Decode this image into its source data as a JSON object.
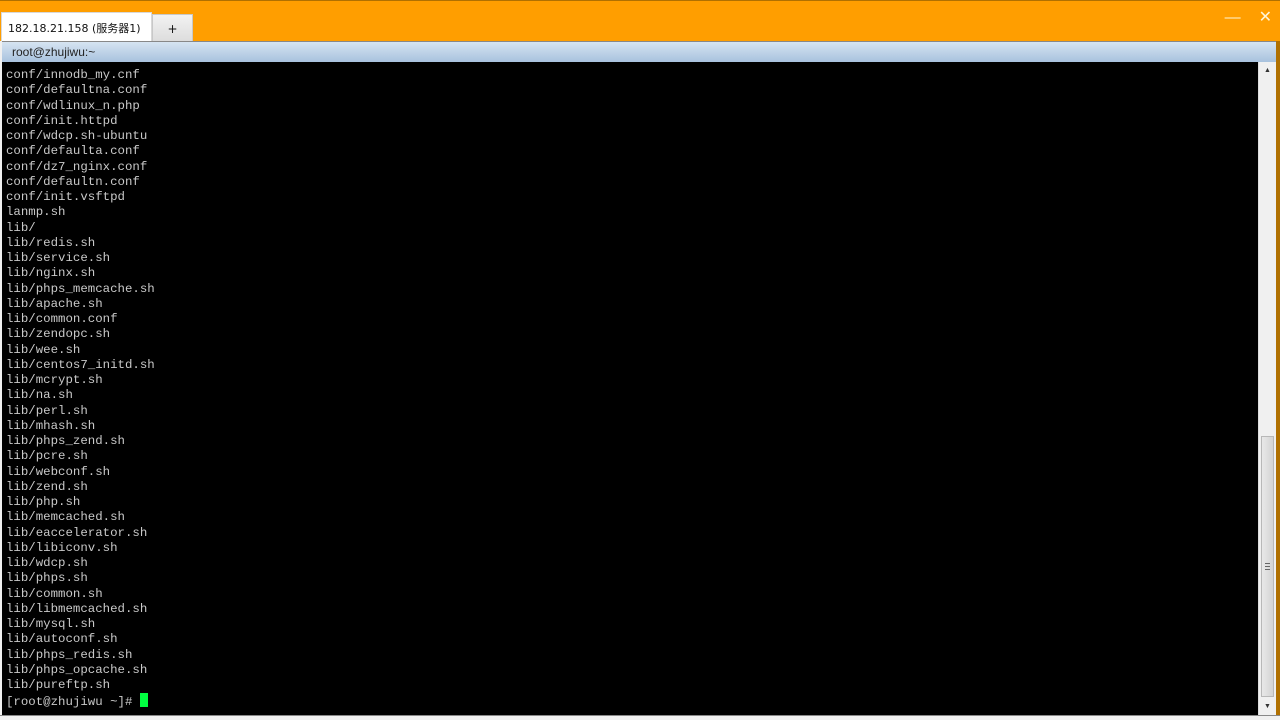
{
  "window": {
    "tabs": [
      {
        "label": "182.18.21.158 (服务器1)",
        "active": true
      },
      {
        "label": "+",
        "active": false
      }
    ],
    "controls": {
      "minimize": "—",
      "close": "✕"
    },
    "accent_color": "#ff9e00"
  },
  "session": {
    "title": "root@zhujiwu:~"
  },
  "terminal": {
    "lines": [
      "conf/innodb_my.cnf",
      "conf/defaultna.conf",
      "conf/wdlinux_n.php",
      "conf/init.httpd",
      "conf/wdcp.sh-ubuntu",
      "conf/defaulta.conf",
      "conf/dz7_nginx.conf",
      "conf/defaultn.conf",
      "conf/init.vsftpd",
      "lanmp.sh",
      "lib/",
      "lib/redis.sh",
      "lib/service.sh",
      "lib/nginx.sh",
      "lib/phps_memcache.sh",
      "lib/apache.sh",
      "lib/common.conf",
      "lib/zendopc.sh",
      "lib/wee.sh",
      "lib/centos7_initd.sh",
      "lib/mcrypt.sh",
      "lib/na.sh",
      "lib/perl.sh",
      "lib/mhash.sh",
      "lib/phps_zend.sh",
      "lib/pcre.sh",
      "lib/webconf.sh",
      "lib/zend.sh",
      "lib/php.sh",
      "lib/memcached.sh",
      "lib/eaccelerator.sh",
      "lib/libiconv.sh",
      "lib/wdcp.sh",
      "lib/phps.sh",
      "lib/common.sh",
      "lib/libmemcached.sh",
      "lib/mysql.sh",
      "lib/autoconf.sh",
      "lib/phps_redis.sh",
      "lib/phps_opcache.sh",
      "lib/pureftp.sh"
    ],
    "prompt": "[root@zhujiwu ~]# ",
    "cursor_color": "#00ff40"
  },
  "scrollbar": {
    "up_arrow": "▲",
    "down_arrow": "▼",
    "position_fraction": 1.0
  }
}
